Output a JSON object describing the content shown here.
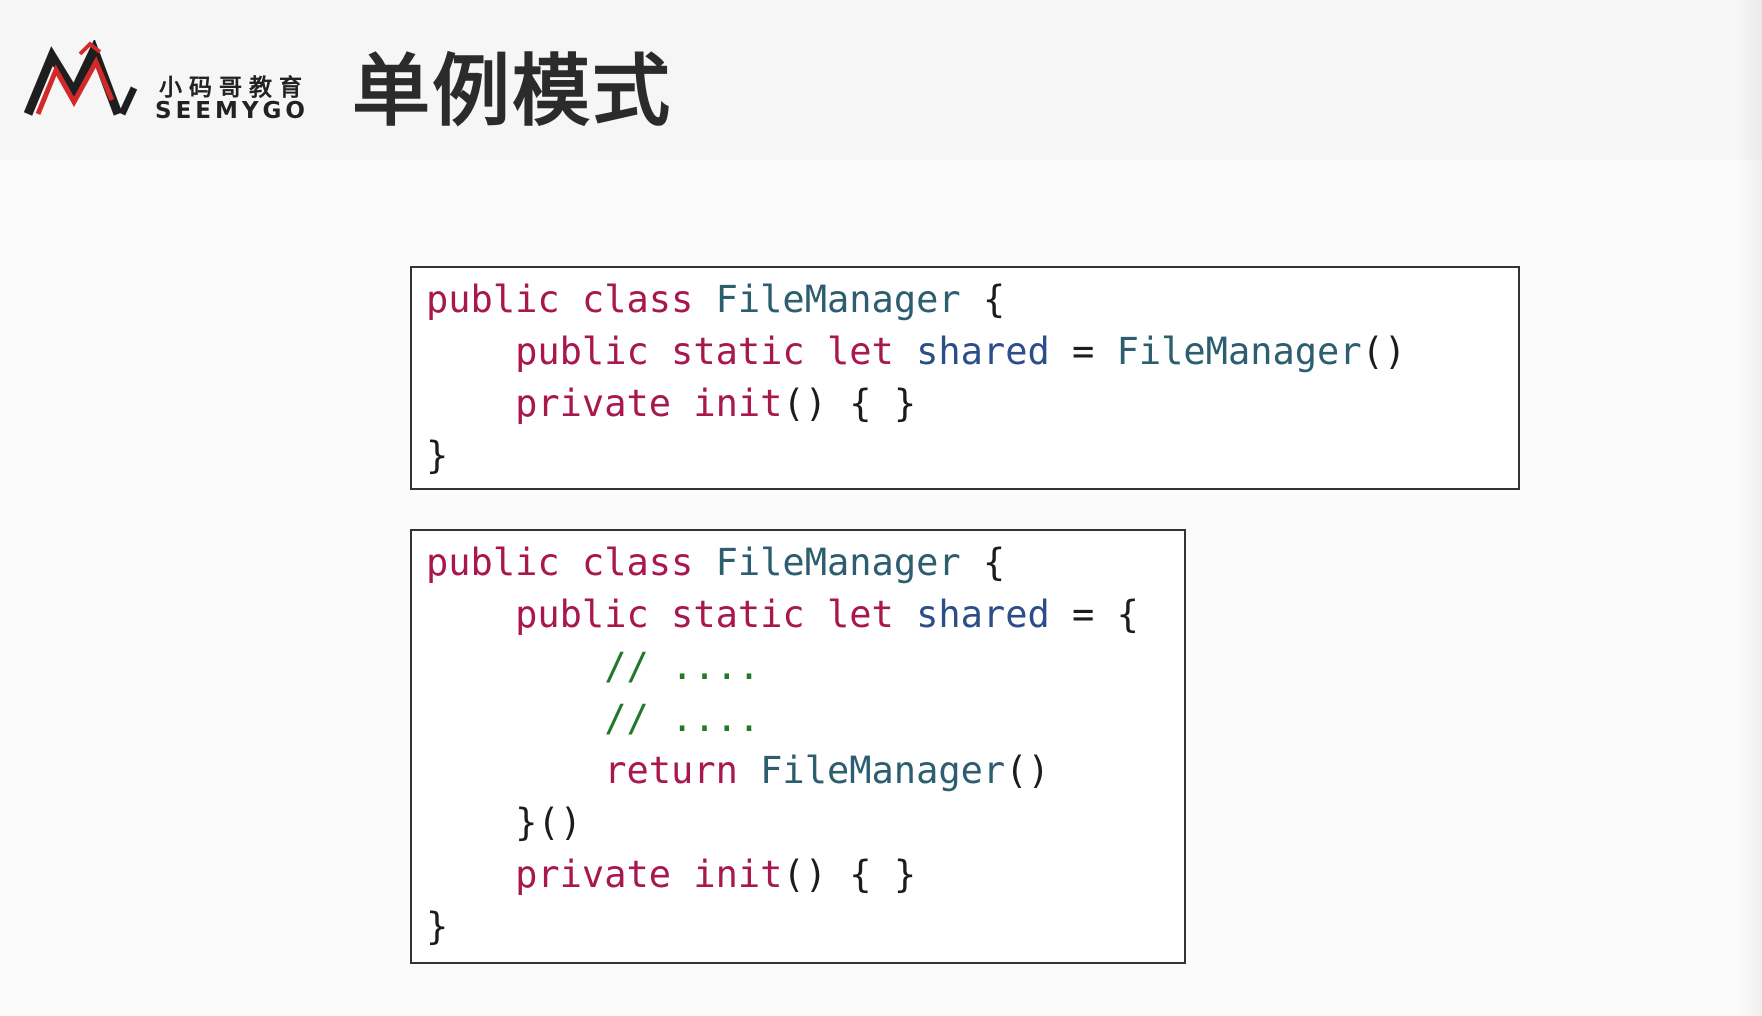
{
  "brand": {
    "cn": "小码哥教育",
    "en": "SEEMYGO",
    "logo_colors": {
      "black": "#1e1e1e",
      "red": "#d22a2a"
    }
  },
  "slide": {
    "title": "单例模式"
  },
  "code_blocks": [
    {
      "lines": [
        [
          [
            "kw",
            "public"
          ],
          [
            "pn",
            " "
          ],
          [
            "kw",
            "class"
          ],
          [
            "pn",
            " "
          ],
          [
            "ty",
            "FileManager"
          ],
          [
            "pn",
            " {"
          ]
        ],
        [
          [
            "pn",
            "    "
          ],
          [
            "kw",
            "public"
          ],
          [
            "pn",
            " "
          ],
          [
            "kw",
            "static"
          ],
          [
            "pn",
            " "
          ],
          [
            "kw",
            "let"
          ],
          [
            "pn",
            " "
          ],
          [
            "id",
            "shared"
          ],
          [
            "pn",
            " = "
          ],
          [
            "ty",
            "FileManager"
          ],
          [
            "pn",
            "()"
          ]
        ],
        [
          [
            "pn",
            "    "
          ],
          [
            "kw",
            "private"
          ],
          [
            "pn",
            " "
          ],
          [
            "kw",
            "init"
          ],
          [
            "pn",
            "() { }"
          ]
        ],
        [
          [
            "pn",
            "}"
          ]
        ]
      ]
    },
    {
      "lines": [
        [
          [
            "kw",
            "public"
          ],
          [
            "pn",
            " "
          ],
          [
            "kw",
            "class"
          ],
          [
            "pn",
            " "
          ],
          [
            "ty",
            "FileManager"
          ],
          [
            "pn",
            " {"
          ]
        ],
        [
          [
            "pn",
            "    "
          ],
          [
            "kw",
            "public"
          ],
          [
            "pn",
            " "
          ],
          [
            "kw",
            "static"
          ],
          [
            "pn",
            " "
          ],
          [
            "kw",
            "let"
          ],
          [
            "pn",
            " "
          ],
          [
            "id",
            "shared"
          ],
          [
            "pn",
            " = {"
          ]
        ],
        [
          [
            "pn",
            "        "
          ],
          [
            "cm",
            "// ...."
          ]
        ],
        [
          [
            "pn",
            "        "
          ],
          [
            "cm",
            "// ...."
          ]
        ],
        [
          [
            "pn",
            "        "
          ],
          [
            "kw",
            "return"
          ],
          [
            "pn",
            " "
          ],
          [
            "ty",
            "FileManager"
          ],
          [
            "pn",
            "()"
          ]
        ],
        [
          [
            "pn",
            "    }()"
          ]
        ],
        [
          [
            "pn",
            "    "
          ],
          [
            "kw",
            "private"
          ],
          [
            "pn",
            " "
          ],
          [
            "kw",
            "init"
          ],
          [
            "pn",
            "() { }"
          ]
        ],
        [
          [
            "pn",
            "}"
          ]
        ]
      ]
    }
  ]
}
